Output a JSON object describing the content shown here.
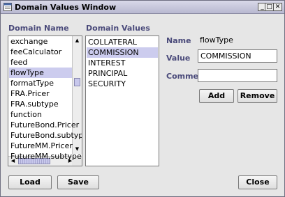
{
  "window": {
    "title": "Domain Values Window"
  },
  "domain_names": {
    "label": "Domain Name",
    "items": [
      "exchange",
      "feeCalculator",
      "feed",
      "flowType",
      "formatType",
      "FRA.Pricer",
      "FRA.subtype",
      "function",
      "FutureBond.Pricer",
      "FutureBond.subtype",
      "FutureMM.Pricer",
      "FutureMM.subtype"
    ],
    "selected": "flowType"
  },
  "domain_values": {
    "label": "Domain Values",
    "items": [
      "COLLATERAL",
      "COMMISSION",
      "INTEREST",
      "PRINCIPAL",
      "SECURITY"
    ],
    "selected": "COMMISSION"
  },
  "form": {
    "name_label": "Name",
    "name_value": "flowType",
    "value_label": "Value",
    "value_value": "COMMISSION",
    "comment_label": "Comment",
    "comment_value": ""
  },
  "buttons": {
    "add": "Add",
    "remove": "Remove",
    "load": "Load",
    "save": "Save",
    "close": "Close"
  }
}
